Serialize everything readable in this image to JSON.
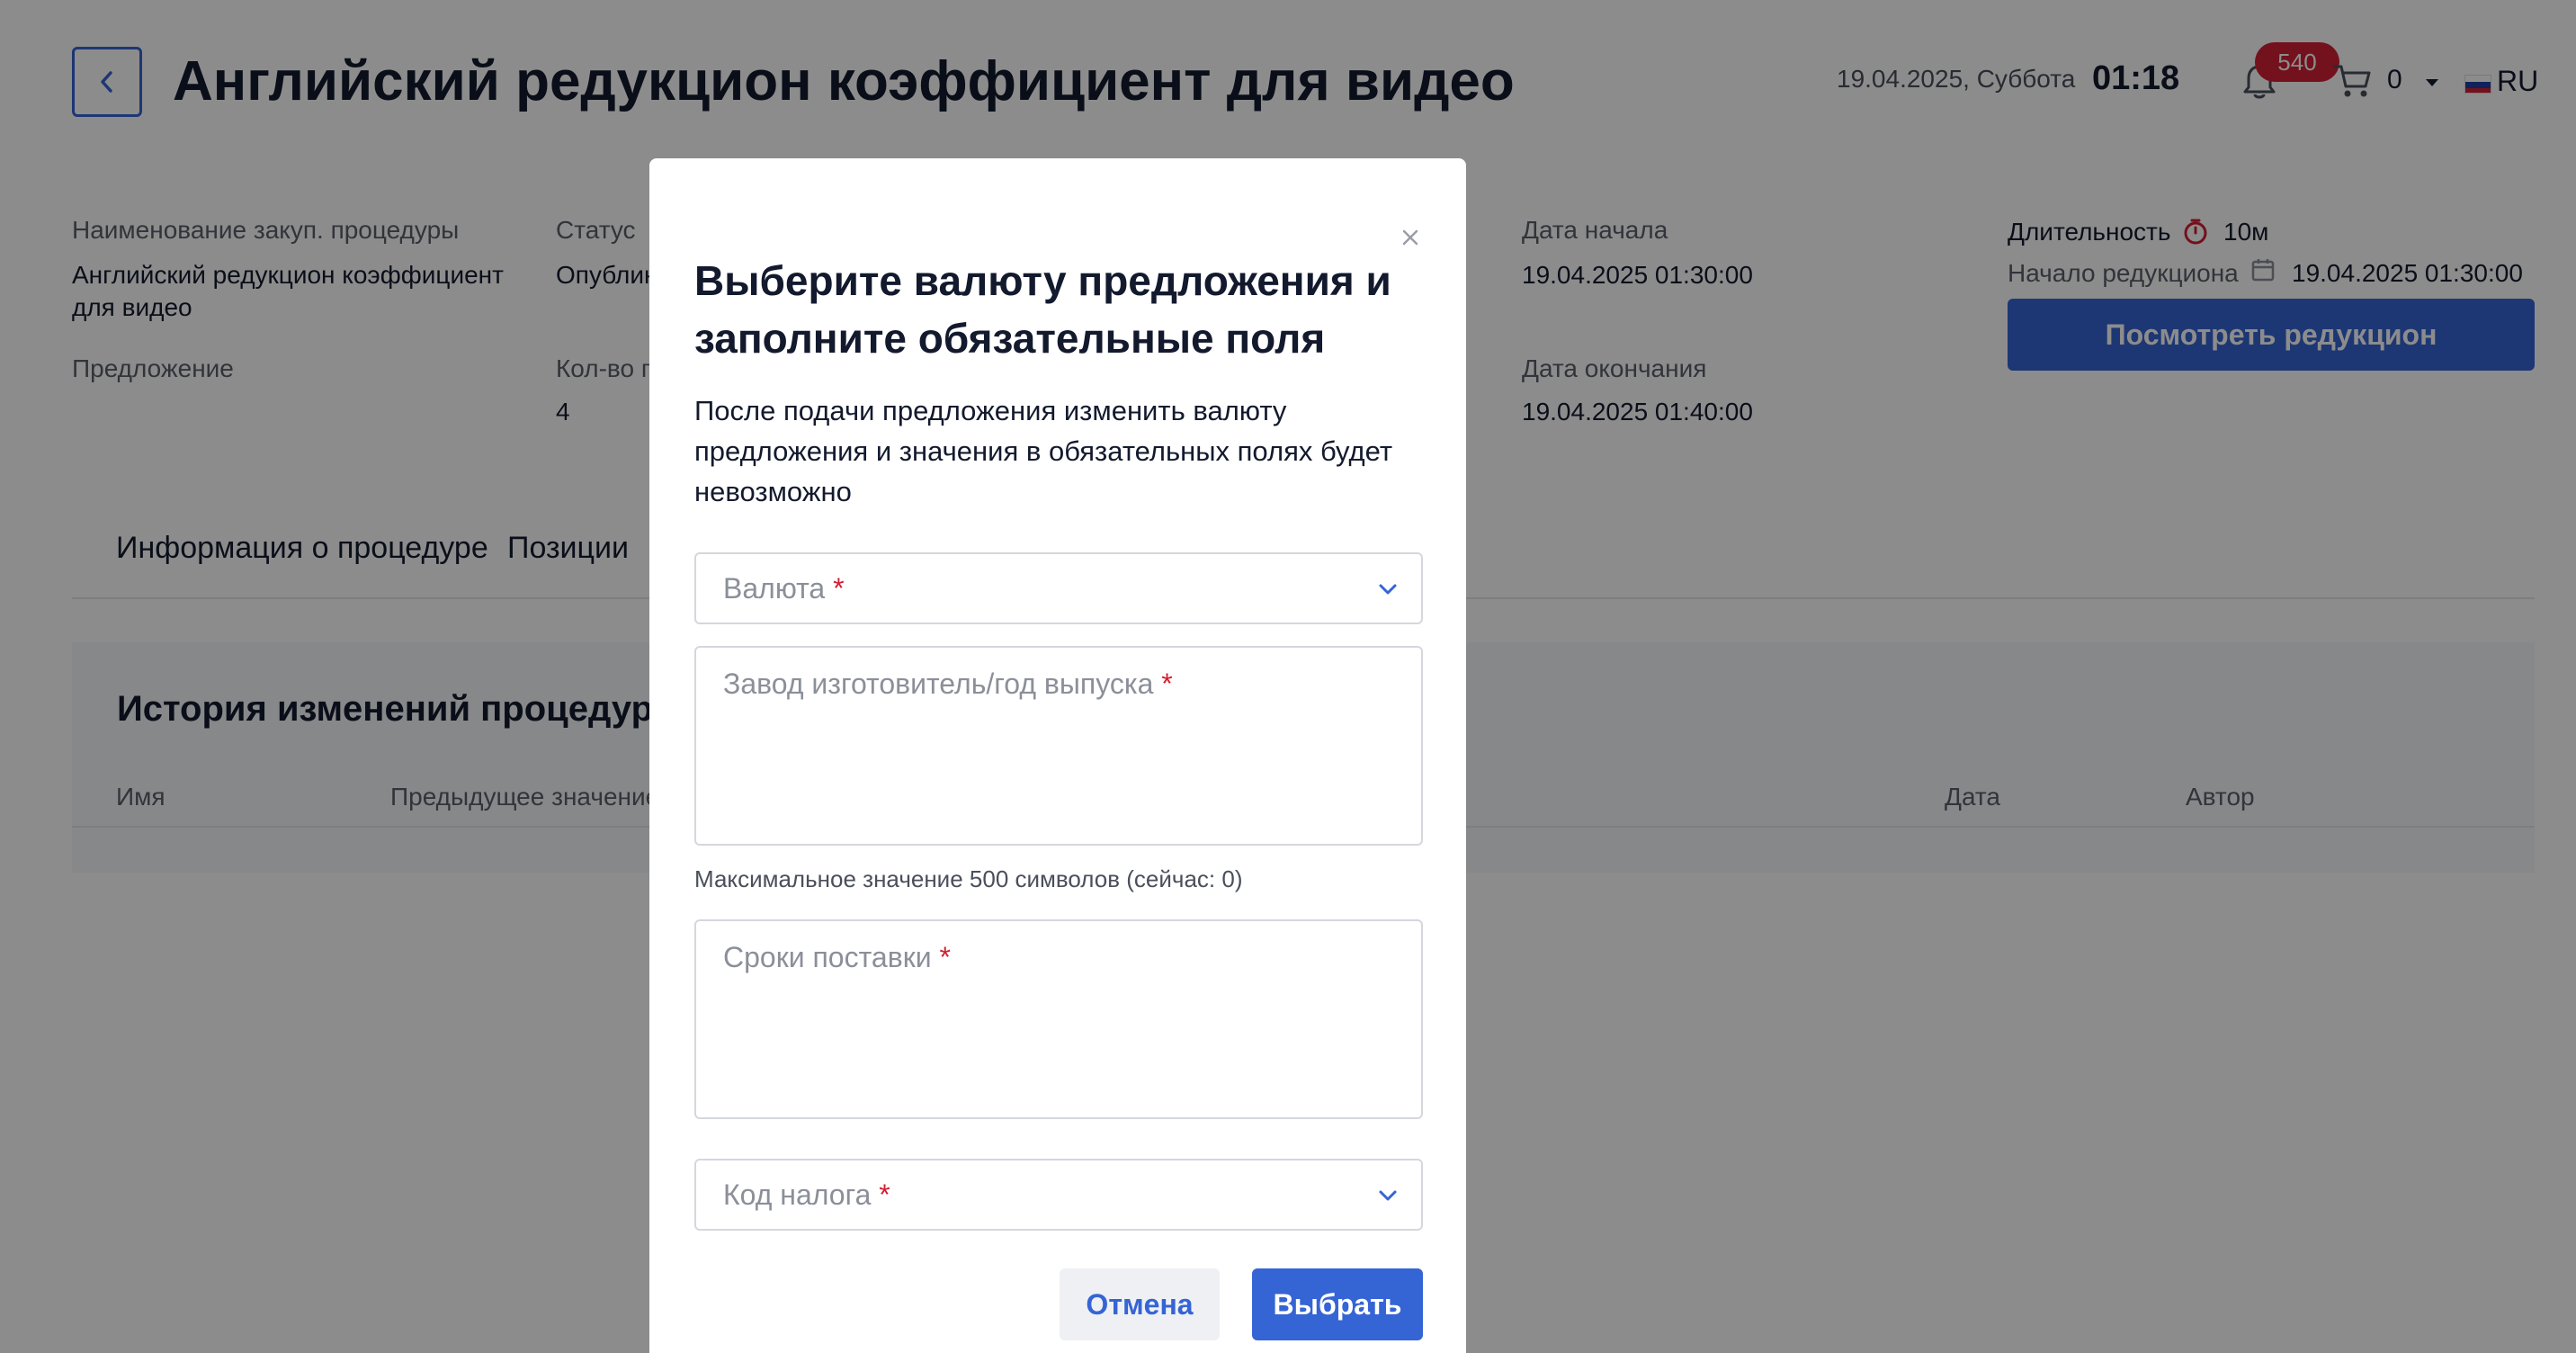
{
  "header": {
    "title": "Английский редукцион коэффициент для видео",
    "date": "19.04.2025, Суббота",
    "time": "01:18",
    "notifications_count": "540",
    "cart_count": "0",
    "language": "RU",
    "back_icon": "chevron-left-icon",
    "bell_icon": "bell-icon",
    "cart_icon": "cart-icon"
  },
  "info": {
    "procedure_name_label": "Наименование закуп. процедуры",
    "procedure_name_value": "Английский редукцион коэффициент для видео",
    "status_label": "Статус",
    "status_value": "Опублин",
    "start_date_label": "Дата начала",
    "start_date_value": "19.04.2025 01:30:00",
    "duration_label": "Длительность",
    "duration_value": "10м",
    "reduction_start_label": "Начало редукциона",
    "reduction_start_value": "19.04.2025 01:30:00",
    "offer_label": "Предложение",
    "quantity_label": "Кол-во п",
    "quantity_value": "4",
    "end_date_label": "Дата окончания",
    "end_date_value": "19.04.2025 01:40:00",
    "view_button": "Посмотреть редукцион"
  },
  "tabs": [
    {
      "label": "Информация о процедуре"
    },
    {
      "label": "Позиции"
    }
  ],
  "history": {
    "title": "История изменений процедуры",
    "columns": [
      "Имя",
      "Предыдущее значение",
      "Дата",
      "Автор"
    ]
  },
  "modal": {
    "title": "Выберите валюту предложения и заполните обязательные поля",
    "description": "После подачи предложения изменить валюту предложения и значения в обязательных полях будет невозможно",
    "currency_placeholder": "Валюта",
    "manufacturer_placeholder": "Завод изготовитель/год выпуска",
    "manufacturer_helper": "Максимальное значение 500 символов (сейчас: 0)",
    "delivery_placeholder": "Сроки поставки",
    "tax_placeholder": "Код налога",
    "required_mark": "*",
    "cancel_button": "Отмена",
    "select_button": "Выбрать"
  },
  "colors": {
    "accent": "#3564d4",
    "badge": "#d21f33",
    "required": "#d21f33",
    "overlay": "rgba(0,0,0,0.45)"
  }
}
